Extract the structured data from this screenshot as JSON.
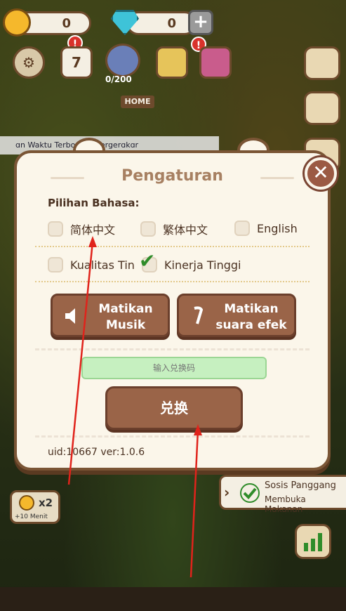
{
  "hud": {
    "coins": "0",
    "gems": "0",
    "calendar_day": "7",
    "piggy_count": "0/200",
    "badge_red": "!",
    "home_sign": "HOME"
  },
  "banner": {
    "text": "ɑn Waktu Terbo ɑng Bergerɑkɑr"
  },
  "dialog": {
    "title": "Pengaturan",
    "language_label": "Pilihan Bahasa:",
    "languages": [
      {
        "label": "简体中文",
        "checked": false
      },
      {
        "label": "繁体中文",
        "checked": false
      },
      {
        "label": "English",
        "checked": false
      }
    ],
    "quality": [
      {
        "label": "Kualitas Tin",
        "checked": false
      },
      {
        "label": "Kinerja Tinggi",
        "checked": true
      }
    ],
    "music_button": {
      "line1": "Matikan",
      "line2": "Musik"
    },
    "sfx_button": {
      "line1": "Matikan",
      "line2": "suara efek"
    },
    "code_placeholder": "输入兑换码",
    "redeem_label": "兑换",
    "footer": "uid:10667 ver:1.0.6",
    "close_symbol": "✕"
  },
  "bottom": {
    "sosis_title": "Sosis Panggang",
    "sosis_sub": "Membuka Makanan",
    "boost_label": "x2",
    "boost_sub": "+10 Menit"
  },
  "colors": {
    "accent_brown": "#9a6448",
    "annotation_red": "#e0231b",
    "check_green": "#2f8c2a"
  }
}
